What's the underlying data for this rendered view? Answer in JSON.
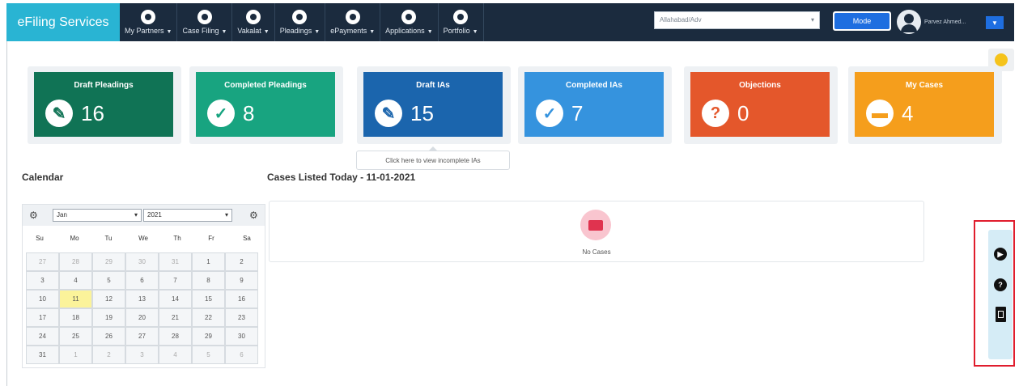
{
  "app": {
    "brand": "eFiling Services"
  },
  "nav": [
    {
      "label": "My Partners",
      "icon": "partners-icon"
    },
    {
      "label": "Case Filing",
      "icon": "case-filing-icon"
    },
    {
      "label": "Vakalat",
      "icon": "vakalat-icon"
    },
    {
      "label": "Pleadings",
      "icon": "pleadings-icon"
    },
    {
      "label": "ePayments",
      "icon": "rupee-icon"
    },
    {
      "label": "Applications",
      "icon": "applications-icon"
    },
    {
      "label": "Portfolio",
      "icon": "portfolio-icon"
    }
  ],
  "header": {
    "court_select": "Allahabad/Adv",
    "mode_button": "Mode",
    "user_name": "Parvez Ahmed..."
  },
  "cards": [
    {
      "title": "Draft Pleadings",
      "value": "16",
      "icon": "edit-icon",
      "glyph": "✎",
      "color": "#107355"
    },
    {
      "title": "Completed Pleadings",
      "value": "8",
      "icon": "check-icon",
      "glyph": "✓",
      "color": "#18a480"
    },
    {
      "title": "Draft IAs",
      "value": "15",
      "icon": "edit-icon",
      "glyph": "✎",
      "color": "#1b65ad"
    },
    {
      "title": "Completed IAs",
      "value": "7",
      "icon": "check-icon",
      "glyph": "✓",
      "color": "#3593de"
    },
    {
      "title": "Objections",
      "value": "0",
      "icon": "question-icon",
      "glyph": "?",
      "color": "#e4572b"
    },
    {
      "title": "My Cases",
      "value": "4",
      "icon": "briefcase-icon",
      "glyph": "▬",
      "color": "#f59e1c"
    }
  ],
  "tooltip": "Click here to view incomplete IAs",
  "calendar": {
    "heading": "Calendar",
    "month": "Jan",
    "year": "2021",
    "weekdays": [
      "Su",
      "Mo",
      "Tu",
      "We",
      "Th",
      "Fr",
      "Sa"
    ],
    "today": "11",
    "days": [
      [
        "27",
        "28",
        "29",
        "30",
        "31",
        "1",
        "2"
      ],
      [
        "3",
        "4",
        "5",
        "6",
        "7",
        "8",
        "9"
      ],
      [
        "10",
        "11",
        "12",
        "13",
        "14",
        "15",
        "16"
      ],
      [
        "17",
        "18",
        "19",
        "20",
        "21",
        "22",
        "23"
      ],
      [
        "24",
        "25",
        "26",
        "27",
        "28",
        "29",
        "30"
      ],
      [
        "31",
        "1",
        "2",
        "3",
        "4",
        "5",
        "6"
      ]
    ]
  },
  "cases": {
    "heading": "Cases Listed Today - 11-01-2021",
    "empty_text": "No Cases"
  }
}
